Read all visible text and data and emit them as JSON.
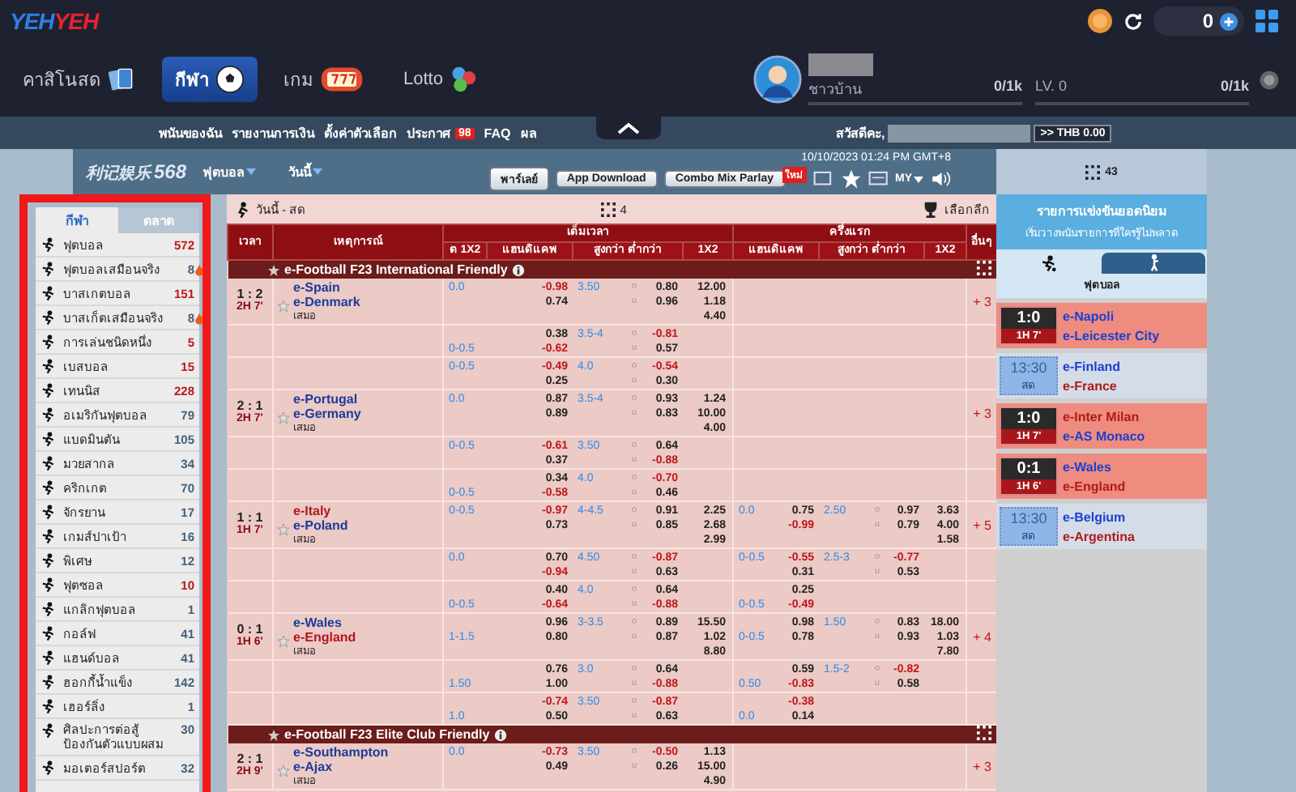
{
  "header": {
    "logo": [
      "YEH",
      "YEH"
    ],
    "balance": "0",
    "nav": [
      {
        "label": "คาสิโนสด",
        "kind": "cards",
        "selected": false
      },
      {
        "label": "กีฬา",
        "kind": "ball",
        "selected": true
      },
      {
        "label": "เกม",
        "kind": "slot",
        "selected": false
      },
      {
        "label": "Lotto",
        "kind": "lotto",
        "selected": false
      }
    ],
    "user": {
      "rank": "ชาวบ้าน",
      "xp": {
        "reading": "0/1k"
      },
      "level_label": "LV. 0",
      "next": {
        "reading": "0/1k"
      }
    }
  },
  "menu": {
    "links": [
      {
        "label": "พนันของฉัน"
      },
      {
        "label": "รายงานการเงิน"
      },
      {
        "label": "ตั้งค่าตัวเลือก"
      },
      {
        "label": "ประกาศ",
        "badge": "98"
      },
      {
        "label": "FAQ"
      },
      {
        "label": "ผล"
      }
    ],
    "greeting": "สวัสดีคะ,",
    "wallet": ">> THB 0.00"
  },
  "subheader": {
    "logo_name": "利记娱乐",
    "logo_number": "568",
    "sport": "ฟุตบอล",
    "day": "วันนี้",
    "datetime": "10/10/2023 01:24 PM GMT+8",
    "buttons": [
      {
        "label": "พาร์เลย์"
      },
      {
        "label": "App Download"
      },
      {
        "label": "Combo Mix Parlay",
        "badge": "ใหม่"
      }
    ],
    "odds_type": "MY",
    "count": "43"
  },
  "sidebar": {
    "tabs": [
      {
        "label": "กีฬา",
        "selected": true
      },
      {
        "label": "ตลาด",
        "selected": false
      }
    ],
    "items": [
      {
        "name": "ฟุตบอล",
        "count": "572",
        "hot": true,
        "trending": false
      },
      {
        "name": "ฟุตบอลเสมือนจริง",
        "count": "8",
        "hot": false,
        "trending": true
      },
      {
        "name": "บาสเกตบอล",
        "count": "151",
        "hot": true,
        "trending": false
      },
      {
        "name": "บาสเก็ตเสมือนจริง",
        "count": "8",
        "hot": false,
        "trending": true
      },
      {
        "name": "การเล่นชนิดหนึ่ง",
        "count": "5",
        "hot": true,
        "trending": false
      },
      {
        "name": "เบสบอล",
        "count": "15",
        "hot": true,
        "trending": false
      },
      {
        "name": "เทนนิส",
        "count": "228",
        "hot": true,
        "trending": false
      },
      {
        "name": "อเมริกันฟุตบอล",
        "count": "79",
        "hot": false,
        "trending": false
      },
      {
        "name": "แบดมินตัน",
        "count": "105",
        "hot": false,
        "trending": false
      },
      {
        "name": "มวยสากล",
        "count": "34",
        "hot": false,
        "trending": false
      },
      {
        "name": "คริกเกต",
        "count": "70",
        "hot": false,
        "trending": false
      },
      {
        "name": "จักรยาน",
        "count": "17",
        "hot": false,
        "trending": false
      },
      {
        "name": "เกมส์ปาเป้า",
        "count": "16",
        "hot": false,
        "trending": false
      },
      {
        "name": "พิเศษ",
        "count": "12",
        "hot": false,
        "trending": false
      },
      {
        "name": "ฟุตซอล",
        "count": "10",
        "hot": true,
        "trending": false
      },
      {
        "name": "แกลิกฟุตบอล",
        "count": "1",
        "hot": false,
        "trending": false
      },
      {
        "name": "กอล์ฟ",
        "count": "41",
        "hot": false,
        "trending": false
      },
      {
        "name": "แฮนด์บอล",
        "count": "41",
        "hot": false,
        "trending": false
      },
      {
        "name": "ฮอกกี้น้ำแข็ง",
        "count": "142",
        "hot": false,
        "trending": false
      },
      {
        "name": "เฮอร์ลิ่ง",
        "count": "1",
        "hot": false,
        "trending": false
      },
      {
        "name": "ศิลปะการต่อสู้ป้องกันตัวแบบผสม",
        "count": "30",
        "hot": false,
        "trending": false
      },
      {
        "name": "มอเตอร์สปอร์ต",
        "count": "32",
        "hot": false,
        "trending": false
      }
    ]
  },
  "table": {
    "title": "วันนี้ - สด",
    "count": "4",
    "league_picker": "เลือกลีก",
    "headers": {
      "time": "เวลา",
      "event": "เหตุการณ์",
      "full_time": "เต็มเวลา",
      "first_half": "ครึ่งแรก",
      "other": "อื่นๆ",
      "ft_cols": [
        "ต 1X2",
        "แฮนดิแคพ",
        "สูงกว่า ต่ำกว่า",
        "1X2"
      ],
      "ht_cols": [
        "แฮนดิแคพ",
        "สูงกว่า ต่ำกว่า",
        "1X2"
      ]
    },
    "leagues": [
      {
        "name": "e-Football F23 International Friendly",
        "rows": [
          {
            "kind": "match",
            "score": "1 : 2",
            "period": "2H 7'",
            "teams": [
              {
                "name": "e-Spain",
                "favored": false
              },
              {
                "name": "e-Denmark",
                "favored": false
              }
            ],
            "draw": "เสมอ",
            "ft": {
              "line_home": "0.0",
              "odds": [
                "-0.98",
                "0.74"
              ],
              "total": "3.50",
              "marks": [
                "o",
                "u"
              ],
              "total_odds": [
                "0.80",
                "0.96"
              ],
              "x12": [
                "12.00",
                "1.18",
                "4.40"
              ]
            },
            "more": "+ 3"
          },
          {
            "kind": "line",
            "ft": {
              "line_away": "0-0.5",
              "odds": [
                "0.38",
                "-0.62"
              ],
              "total": "3.5-4",
              "marks": [
                "o",
                "u"
              ],
              "total_odds": [
                "-0.81",
                "0.57"
              ]
            }
          },
          {
            "kind": "line",
            "ft": {
              "line_home": "0-0.5",
              "odds": [
                "-0.49",
                "0.25"
              ],
              "total": "4.0",
              "marks": [
                "o",
                "u"
              ],
              "total_odds": [
                "-0.54",
                "0.30"
              ]
            }
          },
          {
            "kind": "match",
            "score": "2 : 1",
            "period": "2H 7'",
            "teams": [
              {
                "name": "e-Portugal",
                "favored": false
              },
              {
                "name": "e-Germany",
                "favored": false
              }
            ],
            "draw": "เสมอ",
            "ft": {
              "line_home": "0.0",
              "odds": [
                "0.87",
                "0.89"
              ],
              "total": "3.5-4",
              "marks": [
                "o",
                "u"
              ],
              "total_odds": [
                "0.93",
                "0.83"
              ],
              "x12": [
                "1.24",
                "10.00",
                "4.00"
              ]
            },
            "more": "+ 3"
          },
          {
            "kind": "line",
            "ft": {
              "line_home": "0-0.5",
              "odds": [
                "-0.61",
                "0.37"
              ],
              "total": "3.50",
              "marks": [
                "o",
                "u"
              ],
              "total_odds": [
                "0.64",
                "-0.88"
              ]
            }
          },
          {
            "kind": "line",
            "ft": {
              "line_away": "0-0.5",
              "odds": [
                "0.34",
                "-0.58"
              ],
              "total": "4.0",
              "marks": [
                "o",
                "u"
              ],
              "total_odds": [
                "-0.70",
                "0.46"
              ]
            }
          },
          {
            "kind": "match",
            "score": "1 : 1",
            "period": "1H 7'",
            "teams": [
              {
                "name": "e-Italy",
                "favored": true
              },
              {
                "name": "e-Poland",
                "favored": false
              }
            ],
            "draw": "เสมอ",
            "ft": {
              "line_home": "0-0.5",
              "odds": [
                "-0.97",
                "0.73"
              ],
              "total": "4-4.5",
              "marks": [
                "o",
                "u"
              ],
              "total_odds": [
                "0.91",
                "0.85"
              ],
              "x12": [
                "2.25",
                "2.68",
                "2.99"
              ]
            },
            "ht": {
              "line_home": "0.0",
              "odds": [
                "0.75",
                "-0.99"
              ],
              "total": "2.50",
              "marks": [
                "o",
                "u"
              ],
              "total_odds": [
                "0.97",
                "0.79"
              ],
              "x12": [
                "3.63",
                "4.00",
                "1.58"
              ]
            },
            "more": "+ 5"
          },
          {
            "kind": "line",
            "ft": {
              "line_home": "0.0",
              "odds": [
                "0.70",
                "-0.94"
              ],
              "total": "4.50",
              "marks": [
                "o",
                "u"
              ],
              "total_odds": [
                "-0.87",
                "0.63"
              ]
            },
            "ht": {
              "line_home": "0-0.5",
              "odds": [
                "-0.55",
                "0.31"
              ],
              "total": "2.5-3",
              "marks": [
                "o",
                "u"
              ],
              "total_odds": [
                "-0.77",
                "0.53"
              ]
            }
          },
          {
            "kind": "line",
            "ft": {
              "line_away": "0-0.5",
              "odds": [
                "0.40",
                "-0.64"
              ],
              "total": "4.0",
              "marks": [
                "o",
                "u"
              ],
              "total_odds": [
                "0.64",
                "-0.88"
              ]
            },
            "ht": {
              "line_away": "0-0.5",
              "odds": [
                "0.25",
                "-0.49"
              ]
            }
          },
          {
            "kind": "match",
            "score": "0 : 1",
            "period": "1H 6'",
            "teams": [
              {
                "name": "e-Wales",
                "favored": false
              },
              {
                "name": "e-England",
                "favored": true
              }
            ],
            "draw": "เสมอ",
            "ft": {
              "line_away": "1-1.5",
              "odds": [
                "0.96",
                "0.80"
              ],
              "total": "3-3.5",
              "marks": [
                "o",
                "u"
              ],
              "total_odds": [
                "0.89",
                "0.87"
              ],
              "x12": [
                "15.50",
                "1.02",
                "8.80"
              ]
            },
            "ht": {
              "line_away": "0-0.5",
              "odds": [
                "0.98",
                "0.78"
              ],
              "total": "1.50",
              "marks": [
                "o",
                "u"
              ],
              "total_odds": [
                "0.83",
                "0.93"
              ],
              "x12": [
                "18.00",
                "1.03",
                "7.80"
              ]
            },
            "more": "+ 4"
          },
          {
            "kind": "line",
            "ft": {
              "line_away": "1.50",
              "odds": [
                "0.76",
                "1.00"
              ],
              "total": "3.0",
              "marks": [
                "o",
                "u"
              ],
              "total_odds": [
                "0.64",
                "-0.88"
              ]
            },
            "ht": {
              "line_away": "0.50",
              "odds": [
                "0.59",
                "-0.83"
              ],
              "total": "1.5-2",
              "marks": [
                "o",
                "u"
              ],
              "total_odds": [
                "-0.82",
                "0.58"
              ]
            }
          },
          {
            "kind": "line",
            "ft": {
              "line_away": "1.0",
              "odds": [
                "-0.74",
                "0.50"
              ],
              "total": "3.50",
              "marks": [
                "o",
                "u"
              ],
              "total_odds": [
                "-0.87",
                "0.63"
              ]
            },
            "ht": {
              "line_away": "0.0",
              "odds": [
                "-0.38",
                "0.14"
              ]
            }
          }
        ]
      },
      {
        "name": "e-Football F23 Elite Club Friendly",
        "rows": [
          {
            "kind": "match",
            "score": "2 : 1",
            "period": "2H 9'",
            "teams": [
              {
                "name": "e-Southampton",
                "favored": false
              },
              {
                "name": "e-Ajax",
                "favored": false
              }
            ],
            "draw": "เสมอ",
            "ft": {
              "line_home": "0.0",
              "odds": [
                "-0.73",
                "0.49"
              ],
              "total": "3.50",
              "marks": [
                "o",
                "u"
              ],
              "total_odds": [
                "-0.50",
                "0.26"
              ],
              "x12": [
                "1.13",
                "15.00",
                "4.90"
              ]
            },
            "more": "+ 3"
          }
        ]
      }
    ]
  },
  "popular": {
    "title": "รายการแข่งขันยอดนิยม",
    "subtitle": "เริ่มวางพนันรายการที่ใครรู้ไม่พลาด",
    "tabs": [
      {
        "kind": "soccer",
        "selected": true
      },
      {
        "kind": "runner",
        "selected": false
      }
    ],
    "sport": "ฟุตบอล",
    "matches": [
      {
        "kind": "live",
        "score": "1:0",
        "period": "1H 7'",
        "teams": [
          {
            "name": "e-Napoli",
            "favored": false
          },
          {
            "name": "e-Leicester City",
            "favored": false
          }
        ]
      },
      {
        "kind": "upcoming",
        "time": "13:30",
        "status": "สด",
        "teams": [
          {
            "name": "e-Finland",
            "favored": false
          },
          {
            "name": "e-France",
            "favored": true
          }
        ]
      },
      {
        "kind": "live",
        "score": "1:0",
        "period": "1H 7'",
        "teams": [
          {
            "name": "e-Inter Milan",
            "favored": true
          },
          {
            "name": "e-AS Monaco",
            "favored": false
          }
        ]
      },
      {
        "kind": "live",
        "score": "0:1",
        "period": "1H 6'",
        "teams": [
          {
            "name": "e-Wales",
            "favored": false
          },
          {
            "name": "e-England",
            "favored": true
          }
        ]
      },
      {
        "kind": "upcoming",
        "time": "13:30",
        "status": "สด",
        "teams": [
          {
            "name": "e-Belgium",
            "favored": false
          },
          {
            "name": "e-Argentina",
            "favored": true
          }
        ]
      }
    ]
  }
}
